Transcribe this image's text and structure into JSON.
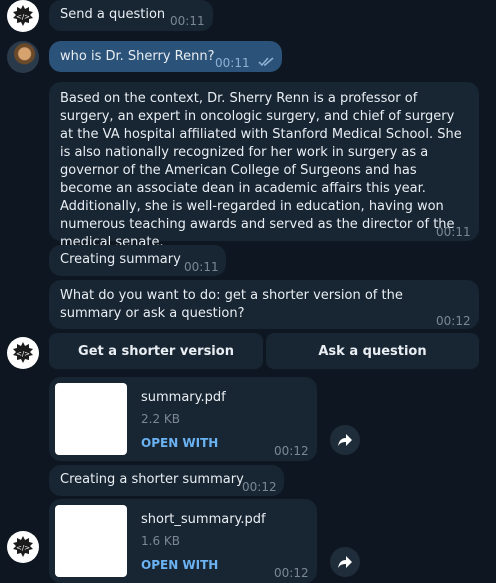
{
  "messages": {
    "m1": {
      "text": "Send a question",
      "time": "00:11"
    },
    "m2": {
      "text": "who is Dr. Sherry Renn?",
      "time": "00:11"
    },
    "m3": {
      "text": "Based on the context, Dr. Sherry Renn is a professor of surgery, an expert in oncologic surgery, and chief of surgery at the VA hospital affiliated with Stanford Medical School. She is also nationally recognized for her work in surgery as a governor of the American College of Surgeons and has become an associate dean in academic affairs this year. Additionally, she is well-regarded in education, having won numerous teaching awards and served as the director of the medical senate.",
      "time": "00:11"
    },
    "m4": {
      "text": "Creating summary",
      "time": "00:11"
    },
    "m5": {
      "text": "What do you want to do: get a shorter version of the summary or ask a question?",
      "time": "00:12"
    },
    "m6": {
      "text": "Creating a shorter summary",
      "time": "00:12"
    }
  },
  "buttons": {
    "shorter": "Get a shorter version",
    "ask": "Ask a question"
  },
  "files": {
    "f1": {
      "name": "summary.pdf",
      "size": "2.2 KB",
      "action": "OPEN WITH",
      "time": "00:12"
    },
    "f2": {
      "name": "short_summary.pdf",
      "size": "1.6 KB",
      "action": "OPEN WITH",
      "time": "00:12"
    }
  },
  "icons": {
    "bot": "bot-avatar-icon",
    "read": "double-check-icon",
    "share": "share-arrow-icon"
  },
  "colors": {
    "background": "#0e1621",
    "incoming_bubble": "#182533",
    "outgoing_bubble": "#2b5278",
    "link": "#6ab2f2"
  }
}
